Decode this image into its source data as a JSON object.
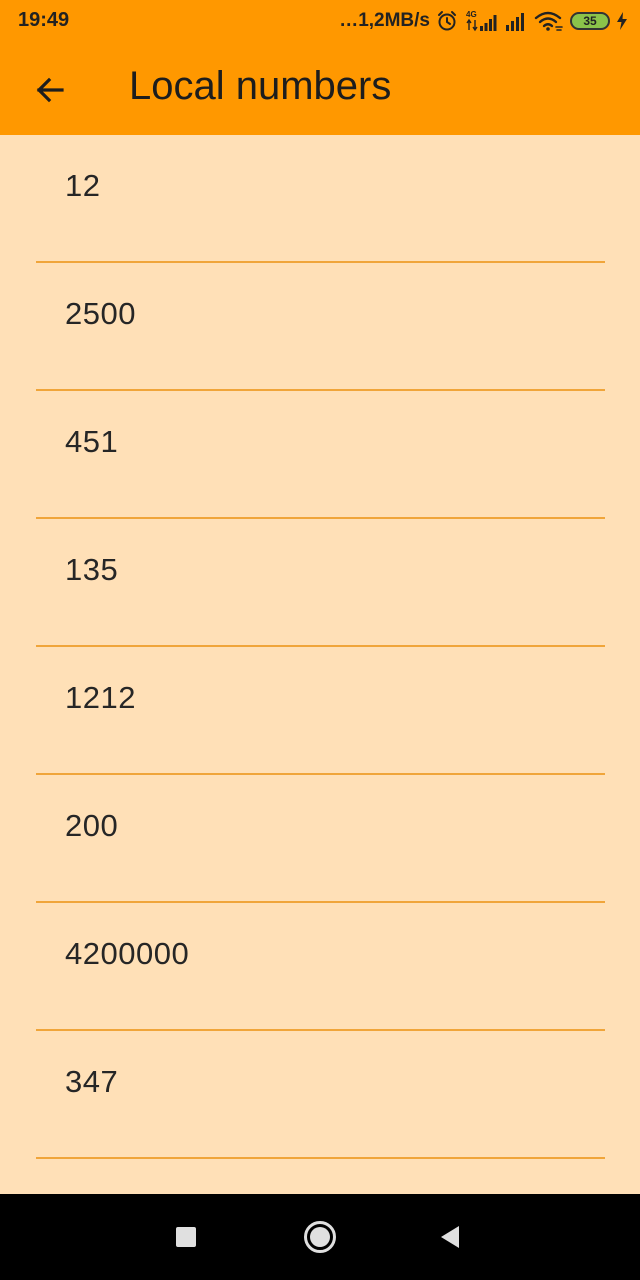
{
  "status_bar": {
    "time": "19:49",
    "net_speed": "…1,2MB/s",
    "network_badge": "4G",
    "battery_level": "35",
    "icons": [
      "alarm-icon",
      "signal-4g-icon",
      "signal-icon",
      "wifi-icon",
      "battery-icon",
      "charging-icon"
    ]
  },
  "app_bar": {
    "title": "Local numbers",
    "back_icon": "arrow-back-icon"
  },
  "numbers": [
    "12",
    "2500",
    "451",
    "135",
    "1212",
    "200",
    "4200000",
    "347"
  ],
  "nav_bar": {
    "icons": [
      "recents-square-icon",
      "home-circle-icon",
      "back-triangle-icon"
    ]
  },
  "colors": {
    "app_bar": "#FF9800",
    "background": "#FFE0B7",
    "divider": "#F0A53A",
    "nav_bar": "#000000"
  }
}
